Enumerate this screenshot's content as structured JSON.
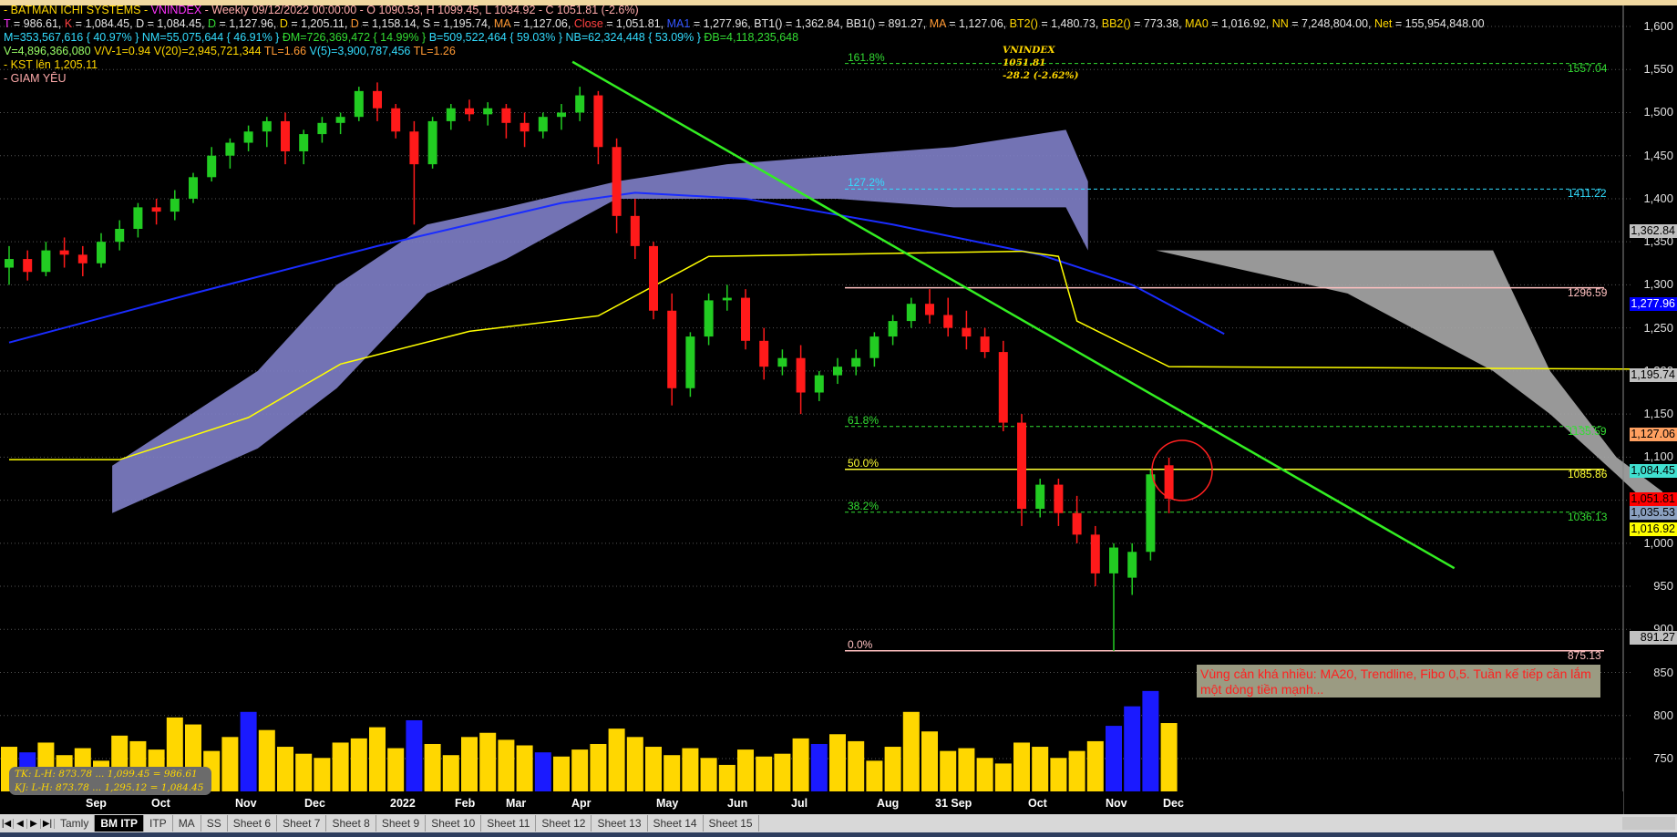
{
  "header": {
    "line1": {
      "prefix": "- BATMAN  ICHI SYSTEMS - ",
      "symbol": "VNINDEX",
      "rest": " - Weekly 09/12/2022 00:00:00 - O 1090.53, H 1099.45, L 1034.92 - C 1051.81 (-2.6%)"
    },
    "line2": [
      {
        "k": "T",
        "v": " = 986.61, ",
        "c": "m"
      },
      {
        "k": "K",
        "v": " = 1,084.45, ",
        "c": "r"
      },
      {
        "k": "D",
        "v": " = 1,084.45, ",
        "c": "w"
      },
      {
        "k": "D",
        "v": " = 1,127.96, ",
        "c": "g"
      },
      {
        "k": "D",
        "v": " = 1,205.11, ",
        "c": "y"
      },
      {
        "k": "D",
        "v": " = 1,158.14, ",
        "c": "o"
      },
      {
        "k": "S",
        "v": " = 1,195.74, ",
        "c": "w"
      },
      {
        "k": "MA",
        "v": " = 1,127.06, ",
        "c": "o"
      },
      {
        "k": "Close",
        "v": " = 1,051.81, ",
        "c": "r"
      },
      {
        "k": "MA1",
        "v": " = 1,277.96, ",
        "c": "b"
      },
      {
        "k": "BT1()",
        "v": " = 1,362.84, ",
        "c": "w"
      },
      {
        "k": "BB1()",
        "v": " = 891.27, ",
        "c": "w"
      },
      {
        "k": "MA",
        "v": " = 1,127.06, ",
        "c": "o"
      },
      {
        "k": "BT2()",
        "v": " = 1,480.73, ",
        "c": "y"
      },
      {
        "k": "BB2()",
        "v": " = 773.38, ",
        "c": "y"
      },
      {
        "k": "MA0",
        "v": " = 1,016.92, ",
        "c": "y"
      },
      {
        "k": "NN",
        "v": " = 7,248,804.00, ",
        "c": "y"
      },
      {
        "k": "Net",
        "v": " = 155,954,848.00",
        "c": "y"
      }
    ],
    "line3": [
      {
        "t": "M=353,567,616 { 40.97% } ",
        "c": "c"
      },
      {
        "t": "NM=55,075,644 { 46.91% } ",
        "c": "c"
      },
      {
        "t": "ĐM=726,369,472 { 14.99% } ",
        "c": "g"
      },
      {
        "t": "B=509,522,464 { 59.03% } ",
        "c": "c"
      },
      {
        "t": "NB=62,324,448 { 53.09% } ",
        "c": "c"
      },
      {
        "t": "ĐB=4,118,235,648",
        "c": "g"
      }
    ],
    "line4": [
      {
        "t": "V=4,896,366,080   ",
        "c": "lg"
      },
      {
        "t": "V/V-1=0.94   ",
        "c": "y"
      },
      {
        "t": "V(20)=2,945,721,344   ",
        "c": "y"
      },
      {
        "t": "TL=1.66   ",
        "c": "o"
      },
      {
        "t": "V(5)=3,900,787,456   ",
        "c": "c"
      },
      {
        "t": "TL=1.26",
        "c": "o"
      }
    ],
    "line5": "- KST lên 1,205.11",
    "line6": "- GIAM YÊU"
  },
  "vnindex_label": {
    "name": "VNINDEX",
    "price": "1051.81",
    "change": "-28.2 (-2.62%)"
  },
  "note": "Vùng cản khá nhiều: MA20, Trendline, Fibo 0,5. Tuần kế tiếp cần lắm một dòng tiền mạnh...",
  "tk_box": {
    "tk": "TK:  L-H: 873.78  ...  1,099.45  =  986.61",
    "kj": "KJ:  L-H: 873.78  ...  1,295.12  =  1,084.45"
  },
  "months": [
    "Sep",
    "Oct",
    "Nov",
    "Dec",
    "2022",
    "Feb",
    "Mar",
    "Apr",
    "May",
    "Jun",
    "Jul",
    "Aug",
    "31 Sep",
    "Oct",
    "Nov",
    "Dec"
  ],
  "tabs": {
    "items": [
      "Tamly",
      "BM ITP",
      "ITP",
      "MA",
      "SS",
      "Sheet 6",
      "Sheet 7",
      "Sheet 8",
      "Sheet 9",
      "Sheet 10",
      "Sheet 11",
      "Sheet 12",
      "Sheet 13",
      "Sheet 14",
      "Sheet 15"
    ],
    "active": "BM ITP"
  },
  "colors": {
    "up": "#22cc22",
    "down": "#ff1a1a",
    "cloud": "#8080c8",
    "cloud2": "#a8a8a8",
    "ma20": "#1a2cff",
    "kijun": "#ffff00",
    "trend": "#33ee22",
    "volume": "#ffd700",
    "volume_alt": "#1a1aff"
  },
  "chart_data": {
    "type": "candlestick",
    "title": "VNINDEX Weekly",
    "ylim": [
      720,
      1620
    ],
    "y_ticks": [
      1600,
      1550,
      1500,
      1450,
      1400,
      1350,
      1300,
      1250,
      1200,
      1150,
      1100,
      1050,
      1000,
      950,
      900,
      850,
      800,
      750
    ],
    "y_tick_labels": [
      "1,600",
      "1,550",
      "1,500",
      "1,450",
      "1,400",
      "1,350",
      "1,300",
      "1,250",
      "1,200",
      "1,150",
      "1,100",
      "1,050",
      "1,000",
      "950",
      "900",
      "850",
      "800",
      "750"
    ],
    "ohlc": [
      [
        1320,
        1345,
        1300,
        1330
      ],
      [
        1330,
        1340,
        1305,
        1315
      ],
      [
        1315,
        1350,
        1310,
        1340
      ],
      [
        1340,
        1355,
        1320,
        1335
      ],
      [
        1335,
        1345,
        1310,
        1325
      ],
      [
        1325,
        1360,
        1320,
        1350
      ],
      [
        1350,
        1375,
        1340,
        1365
      ],
      [
        1365,
        1395,
        1355,
        1390
      ],
      [
        1390,
        1400,
        1370,
        1385
      ],
      [
        1385,
        1410,
        1375,
        1400
      ],
      [
        1400,
        1430,
        1395,
        1425
      ],
      [
        1425,
        1460,
        1420,
        1450
      ],
      [
        1450,
        1470,
        1435,
        1465
      ],
      [
        1465,
        1485,
        1455,
        1478
      ],
      [
        1478,
        1495,
        1460,
        1490
      ],
      [
        1490,
        1500,
        1440,
        1455
      ],
      [
        1455,
        1480,
        1440,
        1475
      ],
      [
        1475,
        1495,
        1465,
        1488
      ],
      [
        1488,
        1500,
        1475,
        1495
      ],
      [
        1495,
        1530,
        1490,
        1525
      ],
      [
        1525,
        1535,
        1490,
        1505
      ],
      [
        1505,
        1510,
        1470,
        1478
      ],
      [
        1478,
        1490,
        1370,
        1440
      ],
      [
        1440,
        1495,
        1435,
        1490
      ],
      [
        1490,
        1510,
        1480,
        1505
      ],
      [
        1505,
        1515,
        1490,
        1498
      ],
      [
        1498,
        1512,
        1485,
        1505
      ],
      [
        1505,
        1510,
        1470,
        1488
      ],
      [
        1488,
        1500,
        1460,
        1478
      ],
      [
        1478,
        1500,
        1470,
        1495
      ],
      [
        1495,
        1510,
        1480,
        1500
      ],
      [
        1500,
        1530,
        1490,
        1520
      ],
      [
        1520,
        1525,
        1440,
        1460
      ],
      [
        1460,
        1470,
        1360,
        1380
      ],
      [
        1380,
        1400,
        1330,
        1345
      ],
      [
        1345,
        1350,
        1260,
        1270
      ],
      [
        1270,
        1290,
        1160,
        1180
      ],
      [
        1180,
        1245,
        1170,
        1240
      ],
      [
        1240,
        1290,
        1230,
        1282
      ],
      [
        1282,
        1300,
        1270,
        1285
      ],
      [
        1285,
        1295,
        1225,
        1235
      ],
      [
        1235,
        1250,
        1190,
        1205
      ],
      [
        1205,
        1225,
        1195,
        1215
      ],
      [
        1215,
        1230,
        1150,
        1175
      ],
      [
        1175,
        1200,
        1165,
        1195
      ],
      [
        1195,
        1215,
        1185,
        1205
      ],
      [
        1205,
        1225,
        1195,
        1215
      ],
      [
        1215,
        1245,
        1205,
        1240
      ],
      [
        1240,
        1265,
        1230,
        1258
      ],
      [
        1258,
        1285,
        1250,
        1278
      ],
      [
        1278,
        1295,
        1255,
        1265
      ],
      [
        1265,
        1285,
        1240,
        1250
      ],
      [
        1250,
        1270,
        1225,
        1240
      ],
      [
        1240,
        1250,
        1215,
        1222
      ],
      [
        1222,
        1235,
        1130,
        1140
      ],
      [
        1140,
        1150,
        1020,
        1040
      ],
      [
        1040,
        1075,
        1030,
        1068
      ],
      [
        1068,
        1075,
        1020,
        1035
      ],
      [
        1035,
        1055,
        1000,
        1010
      ],
      [
        1010,
        1020,
        950,
        965
      ],
      [
        965,
        1000,
        875,
        995
      ],
      [
        960,
        1000,
        940,
        990
      ],
      [
        990,
        1085,
        980,
        1080
      ],
      [
        1090.53,
        1099.45,
        1034.92,
        1051.81
      ]
    ],
    "volume_billion": [
      3.2,
      2.8,
      3.5,
      2.6,
      3.1,
      2.2,
      4.0,
      3.6,
      3.0,
      5.3,
      4.8,
      2.9,
      3.9,
      5.7,
      4.4,
      3.2,
      2.7,
      2.4,
      3.5,
      3.8,
      4.6,
      3.1,
      5.1,
      3.4,
      2.6,
      3.9,
      4.2,
      3.7,
      3.3,
      2.8,
      2.5,
      3.0,
      3.4,
      4.5,
      3.9,
      3.2,
      2.6,
      3.1,
      2.4,
      1.9,
      3.0,
      2.5,
      2.7,
      3.8,
      3.4,
      4.1,
      3.6,
      2.2,
      3.2,
      5.7,
      4.3,
      2.9,
      3.1,
      2.4,
      2.0,
      3.5,
      3.2,
      2.4,
      2.9,
      3.6,
      4.7,
      6.1,
      7.2,
      4.9
    ],
    "volume_blue_idx": [
      1,
      13,
      22,
      29,
      44,
      60,
      61,
      62
    ],
    "cloud_upper": [
      [
        5.6,
        1090
      ],
      [
        13.5,
        1200
      ],
      [
        17.8,
        1300
      ],
      [
        22.7,
        1370
      ],
      [
        27,
        1390
      ],
      [
        33,
        1420
      ],
      [
        39,
        1440
      ],
      [
        45,
        1450
      ],
      [
        51.3,
        1460
      ],
      [
        57.4,
        1480
      ],
      [
        58.6,
        1420
      ]
    ],
    "cloud_lower": [
      [
        5.6,
        1035
      ],
      [
        13.5,
        1110
      ],
      [
        17.8,
        1180
      ],
      [
        22.7,
        1290
      ],
      [
        27,
        1330
      ],
      [
        33,
        1400
      ],
      [
        39,
        1400
      ],
      [
        45,
        1400
      ],
      [
        51.3,
        1390
      ],
      [
        57.4,
        1390
      ],
      [
        58.6,
        1340
      ]
    ],
    "cloud2_upper": [
      [
        62.3,
        1340
      ],
      [
        72.7,
        1340
      ],
      [
        80.6,
        1340
      ],
      [
        83.7,
        1200
      ],
      [
        87.3,
        1100
      ],
      [
        89.8,
        1060
      ]
    ],
    "cloud2_lower": [
      [
        62.3,
        1340
      ],
      [
        72.7,
        1290
      ],
      [
        80.6,
        1200
      ],
      [
        83.7,
        1150
      ],
      [
        87.3,
        1080
      ],
      [
        89.8,
        1030
      ]
    ],
    "ma20": [
      [
        0,
        1233
      ],
      [
        10,
        1290
      ],
      [
        20,
        1345
      ],
      [
        30,
        1395
      ],
      [
        34,
        1407
      ],
      [
        40,
        1400
      ],
      [
        48,
        1370
      ],
      [
        56,
        1335
      ],
      [
        61,
        1300
      ],
      [
        66,
        1243
      ]
    ],
    "kijun": [
      [
        0,
        1097
      ],
      [
        6,
        1097
      ],
      [
        13,
        1146
      ],
      [
        18,
        1208
      ],
      [
        25,
        1246
      ],
      [
        32,
        1264
      ],
      [
        38,
        1333
      ],
      [
        55,
        1339
      ],
      [
        57,
        1333
      ],
      [
        58,
        1258
      ],
      [
        63,
        1205
      ],
      [
        90,
        1202
      ]
    ],
    "trendline": [
      [
        30.6,
        1559
      ],
      [
        78.5,
        971
      ]
    ],
    "levels": [
      {
        "label": "161.8%",
        "value": 1557.04,
        "text": "1557.04",
        "color": "#33dd33",
        "dash": true
      },
      {
        "label": "127.2%",
        "value": 1411.22,
        "text": "1411.22",
        "color": "#33ddff",
        "dash": true
      },
      {
        "label": "",
        "value": 1296.59,
        "text": "1296.59",
        "color": "#ffc0c0",
        "dash": false
      },
      {
        "label": "61.8%",
        "value": 1135.59,
        "text": "1135.59",
        "color": "#33dd33",
        "dash": true
      },
      {
        "label": "50.0%",
        "value": 1085.86,
        "text": "1085.86",
        "color": "#ffff33",
        "dash": false
      },
      {
        "label": "38.2%",
        "value": 1036.13,
        "text": "1036.13",
        "color": "#33dd33",
        "dash": true
      },
      {
        "label": "0.0%",
        "value": 875.13,
        "text": "875.13",
        "color": "#ffc0c0",
        "dash": false
      }
    ],
    "price_tags": [
      {
        "text": "1,362.84",
        "value": 1362.84,
        "bg": "#c0c0c0",
        "fg": "#000"
      },
      {
        "text": "1,277.96",
        "value": 1277.96,
        "bg": "#0000ff",
        "fg": "#fff"
      },
      {
        "text": "1,195.74",
        "value": 1195.74,
        "bg": "#c0c0c0",
        "fg": "#000"
      },
      {
        "text": "1,127.06",
        "value": 1127.06,
        "bg": "#ffa060",
        "fg": "#000"
      },
      {
        "text": "1,084.45",
        "value": 1084.45,
        "bg": "#40e0d0",
        "fg": "#000"
      },
      {
        "text": "1,051.81",
        "value": 1051.81,
        "bg": "#ff0000",
        "fg": "#000"
      },
      {
        "text": "1,035.53",
        "value": 1035.53,
        "bg": "#8aa0c0",
        "fg": "#000"
      },
      {
        "text": "1,016.92",
        "value": 1016.92,
        "bg": "#ffff00",
        "fg": "#000"
      },
      {
        "text": "891.27",
        "value": 891.27,
        "bg": "#c0c0c0",
        "fg": "#000"
      }
    ]
  }
}
